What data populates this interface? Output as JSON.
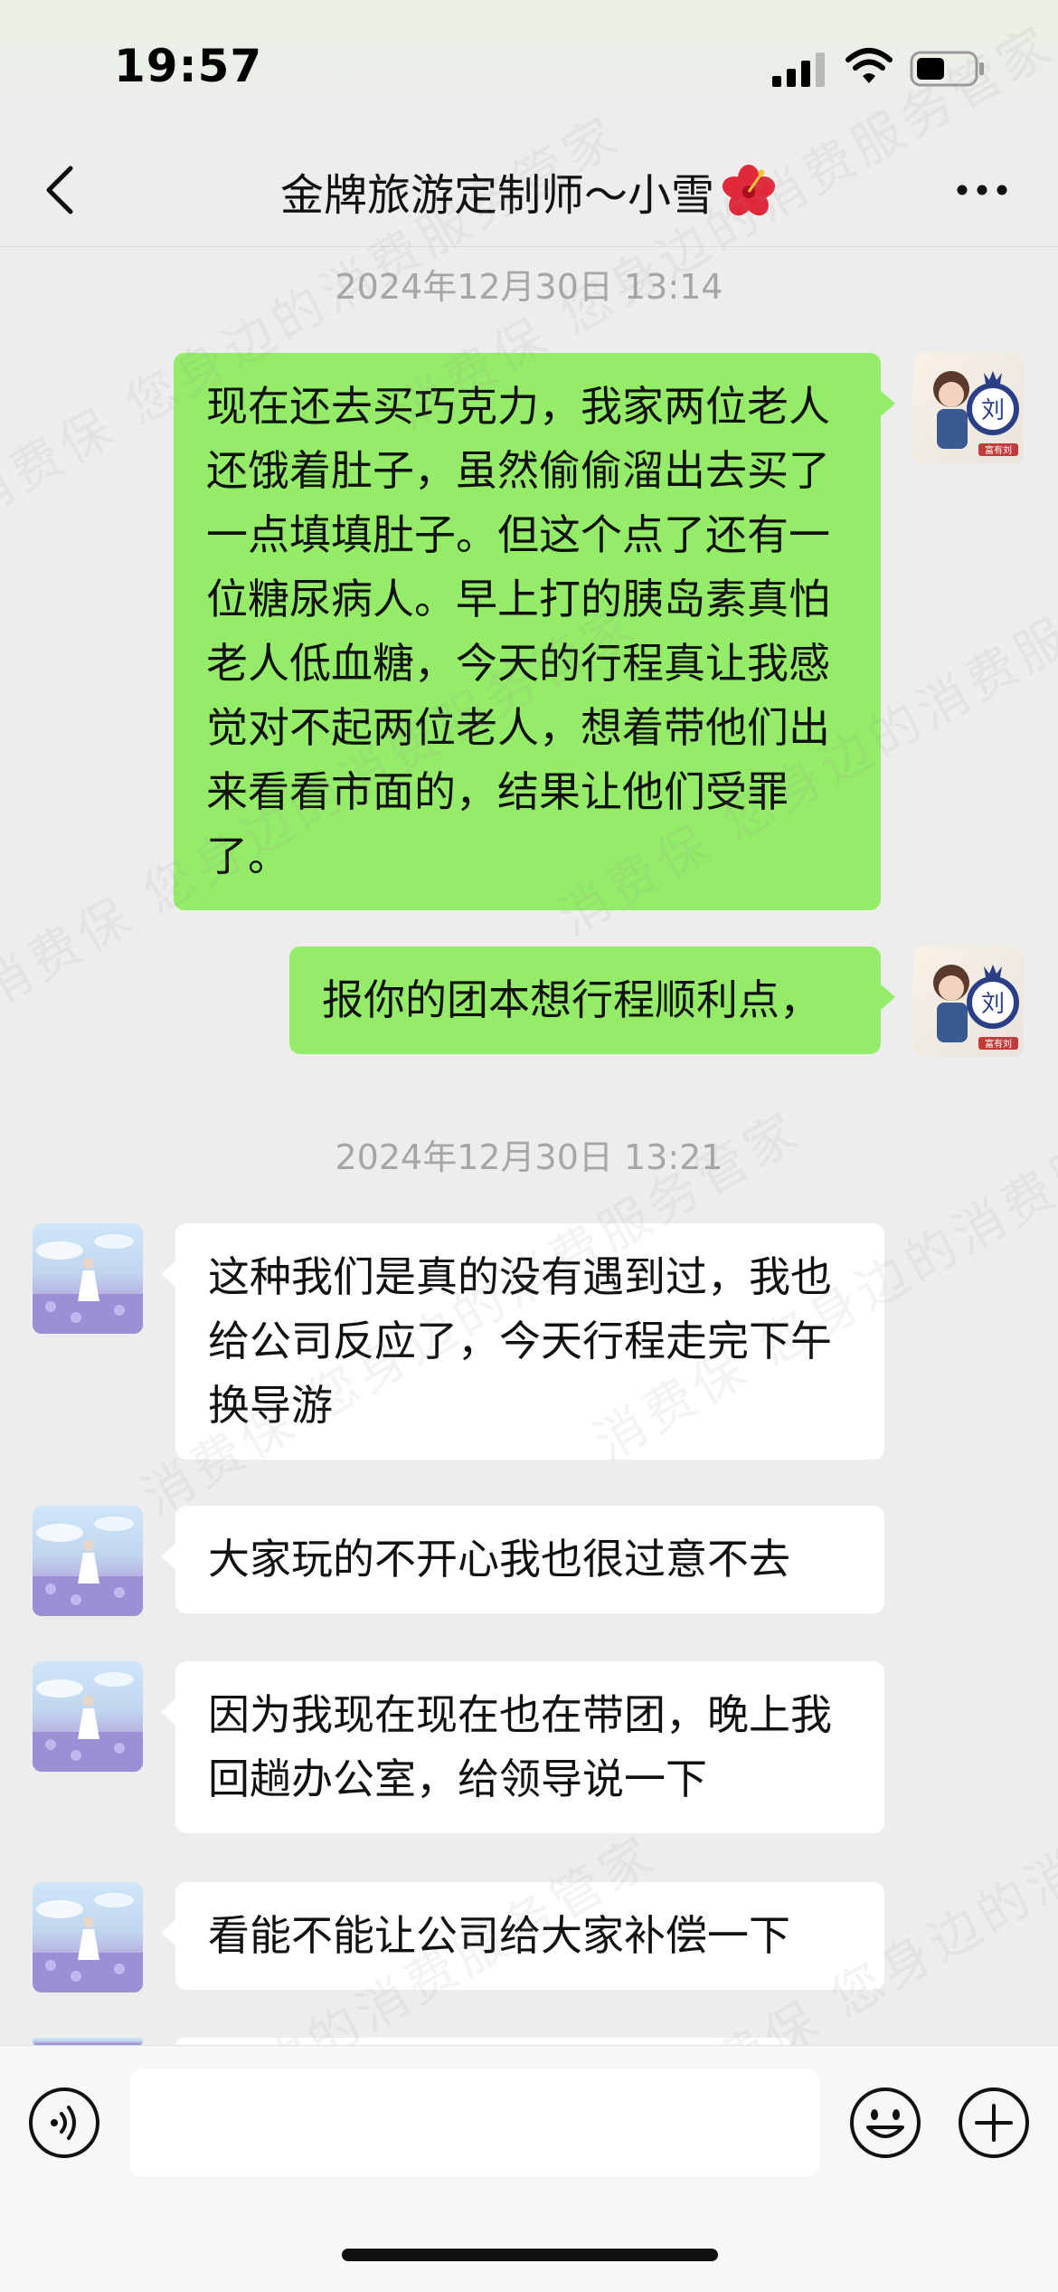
{
  "status_bar": {
    "time": "19:57"
  },
  "header": {
    "title": "金牌旅游定制师～小雪",
    "back_icon": "back-chevron-icon",
    "more_icon": "more-dots-icon",
    "title_emoji": "hibiscus-flower-icon"
  },
  "chat": {
    "timestamps": [
      "2024年12月30日 13:14",
      "2024年12月30日 13:21"
    ],
    "messages": [
      {
        "sender": "self",
        "text": "现在还去买巧克力，我家两位老人还饿着肚子，虽然偷偷溜出去买了一点填填肚子。但这个点了还有一位糖尿病人。早上打的胰岛素真怕老人低血糖，今天的行程真让我感觉对不起两位老人，想着带他们出来看看市面的，结果让他们受罪了。"
      },
      {
        "sender": "self",
        "text": "报你的团本想行程顺利点，"
      },
      {
        "sender": "other",
        "text": "这种我们是真的没有遇到过，我也给公司反应了，今天行程走完下午换导游"
      },
      {
        "sender": "other",
        "text": "大家玩的不开心我也很过意不去"
      },
      {
        "sender": "other",
        "text": "因为我现在现在也在带团，晚上我回趟办公室，给领导说一下"
      },
      {
        "sender": "other",
        "text": "看能不能让公司给大家补偿一下"
      }
    ],
    "self_avatar_text": "刘",
    "self_avatar_caption": "富有刘"
  },
  "watermark": {
    "text": "消费保 您身边的消费服务管家"
  },
  "input_bar": {
    "placeholder": "",
    "voice_icon": "voice-input-icon",
    "emoji_icon": "emoji-face-icon",
    "plus_icon": "plus-circle-icon"
  },
  "colors": {
    "self_bubble": "#95ec69",
    "other_bubble": "#ffffff",
    "background": "#ededed"
  }
}
